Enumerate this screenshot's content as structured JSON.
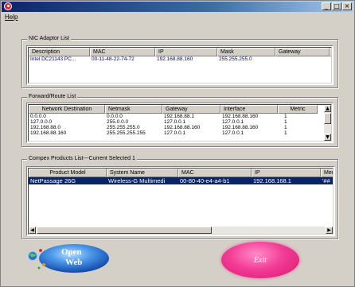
{
  "window": {
    "title": ""
  },
  "title_buttons": {
    "minimize": "_",
    "maximize": "□",
    "close": "×"
  },
  "menu": {
    "help": "Help"
  },
  "nic": {
    "group_title": "NIC Adaptor List",
    "columns": [
      "Description",
      "MAC",
      "IP",
      "Mask",
      "Gateway"
    ],
    "rows": [
      [
        "Intel DC21143 PC...",
        "00-11-48-22-74-72",
        "192.168.88.160",
        "255.255.255.0",
        ""
      ]
    ]
  },
  "route": {
    "group_title": "Forward/Route List",
    "columns": [
      "Network Destination",
      "Netmask",
      "Gateway",
      "Interface",
      "Metric"
    ],
    "rows": [
      [
        "0.0.0.0",
        "0.0.0.0",
        "192.168.88.1",
        "192.168.88.160",
        "1"
      ],
      [
        "127.0.0.0",
        "255.0.0.0",
        "127.0.0.1",
        "127.0.0.1",
        "1"
      ],
      [
        "192.168.88.0",
        "255.255.255.0",
        "192.168.88.160",
        "192.168.88.160",
        "1"
      ],
      [
        "192.168.88.160",
        "255.255.255.255",
        "127.0.0.1",
        "127.0.0.1",
        "1"
      ]
    ]
  },
  "products": {
    "group_title": "Compex Products List---Current Selected 1",
    "columns": [
      "Product Model",
      "System Name",
      "MAC",
      "IP",
      "Mem"
    ],
    "rows": [
      [
        "NetPassage 26G",
        "Wireless-G Multimedi",
        "00-80-40-e4-a4-b1",
        "192.168.168.1",
        "'##"
      ]
    ]
  },
  "buttons": {
    "open_web_line1": "Open",
    "open_web_line2": "Web",
    "exit": "Exit"
  },
  "colors": {
    "selection": "#0a246a",
    "exit_button": "#f23c96",
    "open_web_button": "#1e6fd8"
  }
}
